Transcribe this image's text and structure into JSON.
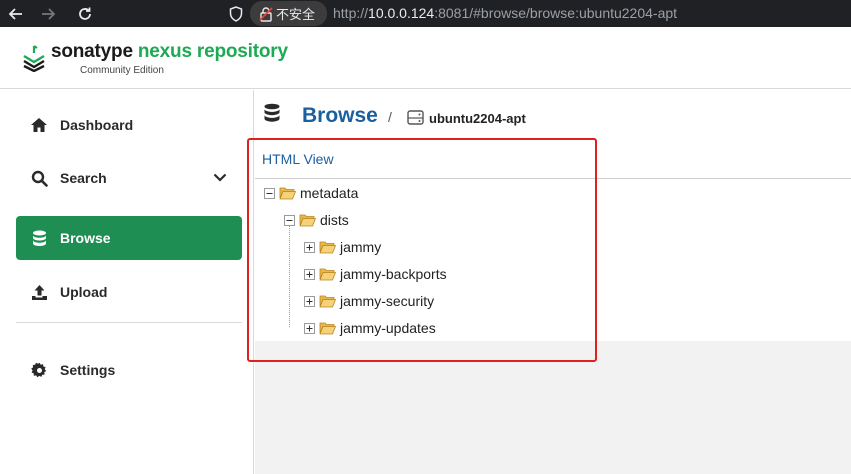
{
  "browser": {
    "security_label": "不安全",
    "url_prefix": "http://",
    "url_host": "10.0.0.124",
    "url_rest": ":8081/#browse/browse:ubuntu2204-apt"
  },
  "brand": {
    "name_part1": "sonatype ",
    "name_part2": "nexus repository",
    "edition": "Community Edition",
    "accent_color": "#1ea954"
  },
  "sidebar": {
    "items": [
      {
        "label": "Dashboard",
        "icon": "home-icon",
        "active": false
      },
      {
        "label": "Search",
        "icon": "search-icon",
        "active": false,
        "expandable": true
      },
      {
        "label": "Browse",
        "icon": "database-icon",
        "active": true
      },
      {
        "label": "Upload",
        "icon": "upload-icon",
        "active": false
      },
      {
        "label": "Settings",
        "icon": "gear-icon",
        "active": false
      }
    ],
    "active_color": "#1e8e52"
  },
  "breadcrumb": {
    "title": "Browse",
    "separator": "/",
    "repository": "ubuntu2204-apt"
  },
  "view": {
    "html_view_link": "HTML View"
  },
  "tree": {
    "nodes": [
      {
        "name": "metadata",
        "expanded": true
      },
      {
        "name": "dists",
        "expanded": true
      },
      {
        "name": "jammy",
        "expanded": false
      },
      {
        "name": "jammy-backports",
        "expanded": false
      },
      {
        "name": "jammy-security",
        "expanded": false
      },
      {
        "name": "jammy-updates",
        "expanded": false
      }
    ]
  }
}
